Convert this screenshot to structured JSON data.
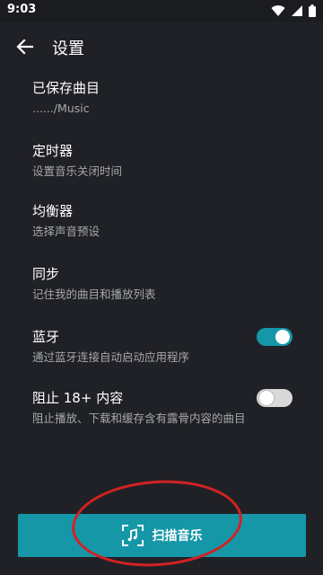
{
  "status_bar": {
    "time": "9:03",
    "icons": [
      "wifi-icon",
      "signal-icon",
      "battery-icon"
    ]
  },
  "app_bar": {
    "back_icon": "arrow-left-icon",
    "title": "设置"
  },
  "settings": [
    {
      "title": "已保存曲目",
      "subtitle": "....../Music"
    },
    {
      "title": "定时器",
      "subtitle": "设置音乐关闭时间"
    },
    {
      "title": "均衡器",
      "subtitle": "选择声音预设"
    },
    {
      "title": "同步",
      "subtitle": "记住我的曲目和播放列表"
    },
    {
      "title": "蓝牙",
      "subtitle": "通过蓝牙连接自动启动应用程序",
      "toggle": true
    },
    {
      "title": "阻止 18+ 内容",
      "subtitle": "阻止播放、下载和缓存含有露骨内容的曲目",
      "toggle": false
    }
  ],
  "scan_button": {
    "label": "扫描音乐",
    "icon": "music-scan-icon"
  },
  "colors": {
    "background": "#202126",
    "accent": "#1597a8",
    "annotation": "#d22222"
  }
}
